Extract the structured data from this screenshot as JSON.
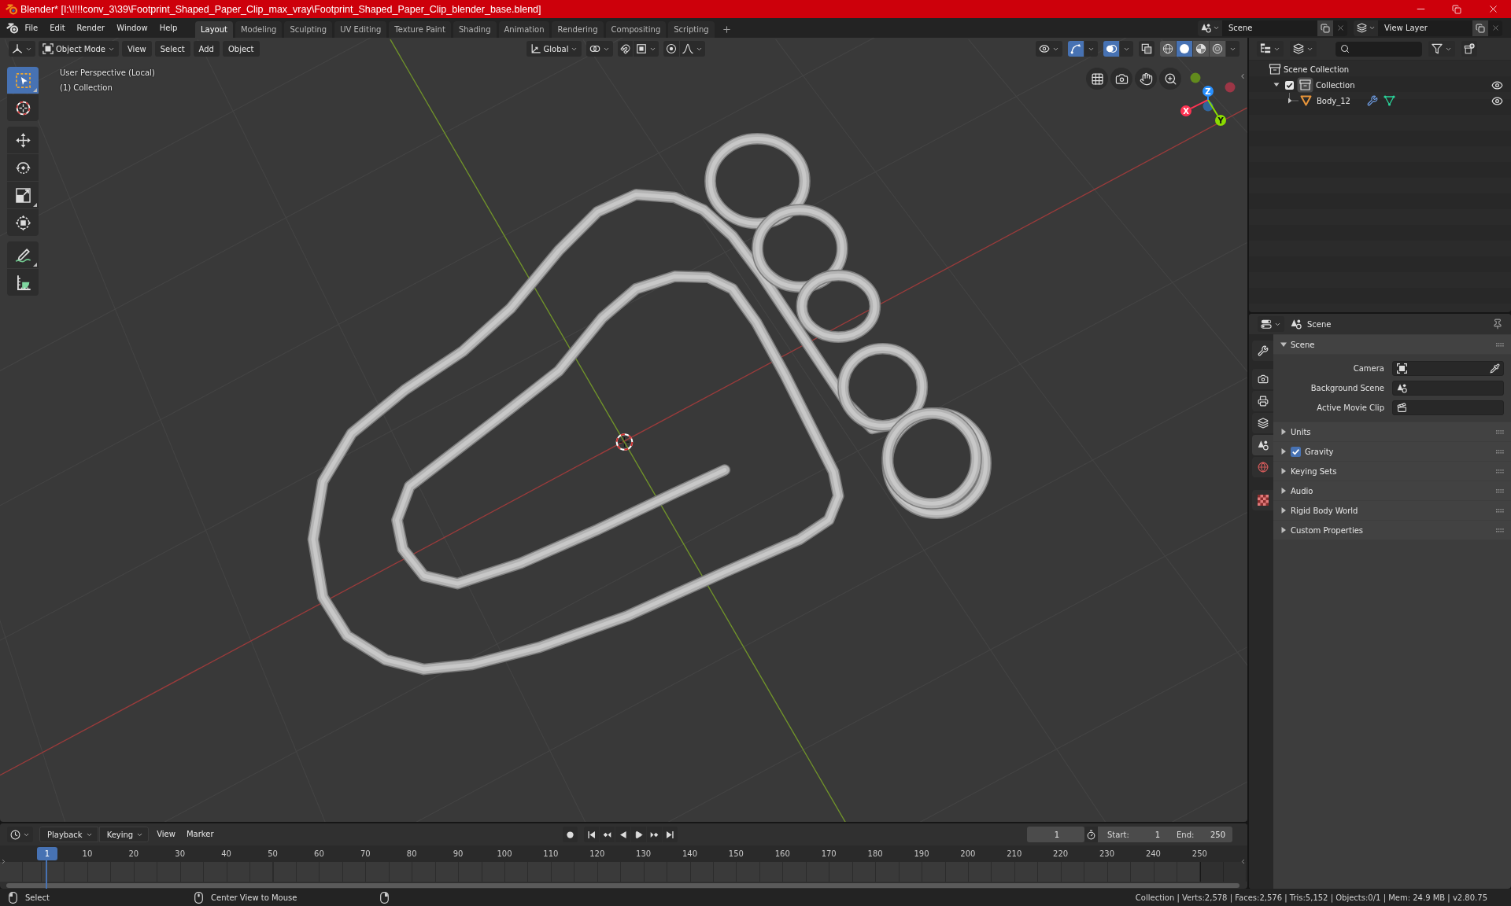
{
  "title_bar": {
    "title": "Blender* [I:\\!!!!conv_3\\39\\Footprint_Shaped_Paper_Clip_max_vray\\Footprint_Shaped_Paper_Clip_blender_base.blend]"
  },
  "top_bar": {
    "menus": [
      "File",
      "Edit",
      "Render",
      "Window",
      "Help"
    ],
    "workspace_tabs": [
      {
        "label": "Layout",
        "selected": true
      },
      {
        "label": "Modeling",
        "selected": false
      },
      {
        "label": "Sculpting",
        "selected": false
      },
      {
        "label": "UV Editing",
        "selected": false
      },
      {
        "label": "Texture Paint",
        "selected": false
      },
      {
        "label": "Shading",
        "selected": false
      },
      {
        "label": "Animation",
        "selected": false
      },
      {
        "label": "Rendering",
        "selected": false
      },
      {
        "label": "Compositing",
        "selected": false
      },
      {
        "label": "Scripting",
        "selected": false
      }
    ],
    "scene": "Scene",
    "view_layer": "View Layer"
  },
  "viewport": {
    "header": {
      "mode": "Object Mode",
      "menus": [
        "View",
        "Select",
        "Add",
        "Object"
      ],
      "orientation": "Global",
      "toggles": [
        {
          "kind": "snap",
          "on": false
        },
        {
          "kind": "proportional",
          "on": false
        },
        {
          "kind": "gizmos",
          "on": true
        },
        {
          "kind": "overlays",
          "on": true
        },
        {
          "kind": "xray",
          "on": false
        }
      ],
      "shading": [
        {
          "kind": "wireframe",
          "selected": false
        },
        {
          "kind": "solid",
          "selected": true
        },
        {
          "kind": "material",
          "selected": false
        },
        {
          "kind": "rendered",
          "selected": false
        }
      ]
    },
    "overlay_text": [
      "User Perspective (Local)",
      "(1) Collection"
    ],
    "tools": [
      {
        "kind": "select_box",
        "selected": true
      },
      {
        "kind": "cursor",
        "selected": false
      },
      {
        "kind": "move",
        "selected": false
      },
      {
        "kind": "rotate",
        "selected": false
      },
      {
        "kind": "scale",
        "selected": false
      },
      {
        "kind": "transform",
        "selected": false
      },
      {
        "kind": "annotate",
        "selected": false
      },
      {
        "kind": "measure",
        "selected": false
      }
    ],
    "gizmo_axes": [
      {
        "label": "X",
        "color": "#ff3352"
      },
      {
        "label": "Y",
        "color": "#8bdc00"
      },
      {
        "label": "Z",
        "color": "#2890ff"
      }
    ]
  },
  "outliner": {
    "tree": [
      {
        "kind": "scene_collection",
        "label": "Scene Collection",
        "children": [
          {
            "kind": "collection",
            "label": "Collection",
            "expanded": true,
            "checked": true,
            "active": true,
            "visible": true,
            "children": [
              {
                "kind": "object",
                "label": "Body_12",
                "expanded": false,
                "active": false,
                "visible": true
              }
            ]
          }
        ]
      }
    ]
  },
  "properties": {
    "context": "Scene",
    "tabs": [
      {
        "kind": "tool",
        "selected": false
      },
      {
        "kind": "render",
        "selected": false
      },
      {
        "kind": "output",
        "selected": false
      },
      {
        "kind": "view_layer",
        "selected": false
      },
      {
        "kind": "scene",
        "selected": true
      },
      {
        "kind": "world",
        "selected": false
      },
      {
        "kind": "texture",
        "selected": false
      }
    ],
    "panels": [
      {
        "kind": "plain",
        "title": "Scene",
        "expanded": true,
        "fields": [
          {
            "kind": "camera",
            "label": "Camera"
          },
          {
            "kind": "scene",
            "label": "Background Scene"
          },
          {
            "kind": "movie_clip",
            "label": "Active Movie Clip"
          }
        ]
      },
      {
        "kind": "plain",
        "title": "Units",
        "expanded": false
      },
      {
        "kind": "toggle",
        "title": "Gravity",
        "expanded": false,
        "checked": true
      },
      {
        "kind": "plain",
        "title": "Keying Sets",
        "expanded": false
      },
      {
        "kind": "plain",
        "title": "Audio",
        "expanded": false
      },
      {
        "kind": "plain",
        "title": "Rigid Body World",
        "expanded": false
      },
      {
        "kind": "plain",
        "title": "Custom Properties",
        "expanded": false
      }
    ]
  },
  "timeline": {
    "dropdowns": [
      "Playback",
      "Keying"
    ],
    "menus": [
      "View",
      "Marker"
    ],
    "current_frame": "1",
    "start_label": "Start:",
    "start": "1",
    "end_label": "End:",
    "end": "250",
    "playhead": "1",
    "ruler": [
      "10",
      "20",
      "30",
      "40",
      "50",
      "60",
      "70",
      "80",
      "90",
      "100",
      "110",
      "120",
      "130",
      "140",
      "150",
      "160",
      "170",
      "180",
      "190",
      "200",
      "210",
      "220",
      "230",
      "240",
      "250"
    ]
  },
  "status_bar": {
    "hints": [
      "Select",
      "Center View to Mouse"
    ],
    "stats": "Collection | Verts:2,578 | Faces:2,576 | Tris:5,152 | Objects:0/1 | Mem: 24.9 MB | v2.80.75"
  }
}
